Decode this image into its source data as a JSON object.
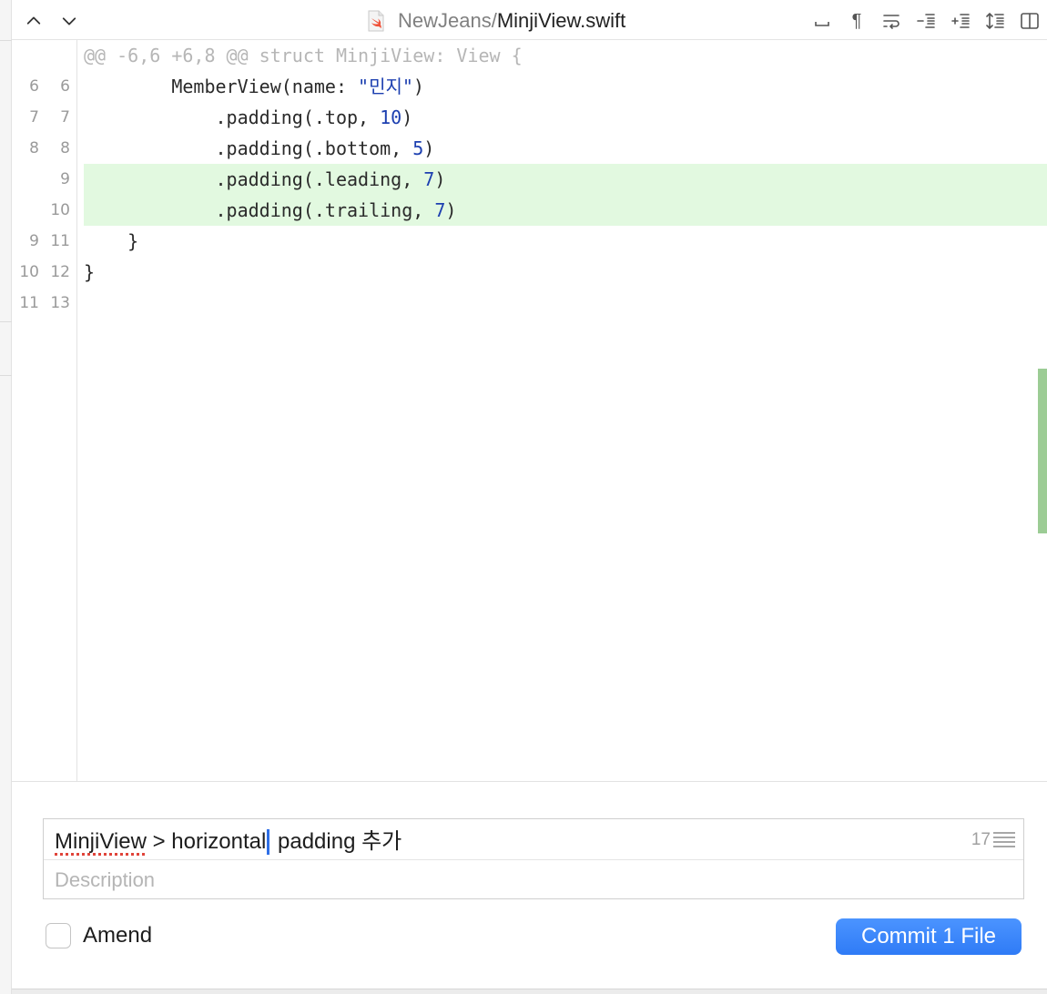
{
  "header": {
    "title_path": "NewJeans/",
    "title_file": "MinjiView.swift",
    "file_icon": "swift-file-icon",
    "nav": {
      "prev_icon": "chevron-up-icon",
      "next_icon": "chevron-down-icon"
    },
    "tools": [
      {
        "name": "show-whitespace-icon"
      },
      {
        "name": "show-invisibles-icon",
        "glyph": "¶"
      },
      {
        "name": "wrap-lines-icon"
      },
      {
        "name": "collapse-removed-icon"
      },
      {
        "name": "collapse-added-icon"
      },
      {
        "name": "expand-context-icon"
      },
      {
        "name": "side-by-side-icon"
      }
    ]
  },
  "diff": {
    "hunk_header": "@@ -6,6 +6,8 @@ struct MinjiView: View {",
    "lines": [
      {
        "old": "6",
        "new": "6",
        "type": "context",
        "indent": "        ",
        "parts": [
          [
            "MemberView(name: ",
            "plain"
          ],
          [
            "\"민지\"",
            "str"
          ],
          [
            ")",
            "plain"
          ]
        ]
      },
      {
        "old": "7",
        "new": "7",
        "type": "context",
        "indent": "            ",
        "parts": [
          [
            ".padding(.top, ",
            "plain"
          ],
          [
            "10",
            "num"
          ],
          [
            ")",
            "plain"
          ]
        ]
      },
      {
        "old": "8",
        "new": "8",
        "type": "context",
        "indent": "            ",
        "parts": [
          [
            ".padding(.bottom, ",
            "plain"
          ],
          [
            "5",
            "num"
          ],
          [
            ")",
            "plain"
          ]
        ]
      },
      {
        "old": "",
        "new": "9",
        "type": "added",
        "indent": "            ",
        "parts": [
          [
            ".padding(.leading, ",
            "plain"
          ],
          [
            "7",
            "num"
          ],
          [
            ")",
            "plain"
          ]
        ]
      },
      {
        "old": "",
        "new": "10",
        "type": "added",
        "indent": "            ",
        "parts": [
          [
            ".padding(.trailing, ",
            "plain"
          ],
          [
            "7",
            "num"
          ],
          [
            ")",
            "plain"
          ]
        ]
      },
      {
        "old": "9",
        "new": "11",
        "type": "context",
        "indent": "    ",
        "parts": [
          [
            "}",
            "plain"
          ]
        ]
      },
      {
        "old": "10",
        "new": "12",
        "type": "context",
        "indent": "",
        "parts": [
          [
            "}",
            "plain"
          ]
        ]
      },
      {
        "old": "11",
        "new": "13",
        "type": "context",
        "indent": "",
        "parts": [
          [
            "",
            "plain"
          ]
        ]
      }
    ]
  },
  "commit": {
    "message_misspelled": "MinjiView",
    "message_before_caret": " > horizontal",
    "message_after_caret": " padding 추가",
    "char_count": "17",
    "description_placeholder": "Description",
    "amend_label": "Amend",
    "amend_checked": false,
    "commit_label": "Commit 1 File"
  },
  "colors": {
    "added_background": "#e2f9e0",
    "scroll_marker": "#9ccc95",
    "accent": "#2f7bf6",
    "token_literal": "#1c3fb0"
  }
}
